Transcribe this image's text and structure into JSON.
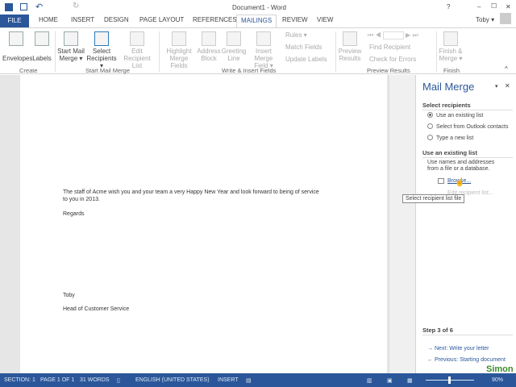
{
  "window": {
    "title": "Document1 - Word",
    "help": "?",
    "minimize": "–",
    "maximize": "☐",
    "close": "✕"
  },
  "qat": {
    "undo": "↶",
    "redo": "↻"
  },
  "user": {
    "name": "Toby ▾"
  },
  "tabs": [
    "FILE",
    "HOME",
    "INSERT",
    "DESIGN",
    "PAGE LAYOUT",
    "REFERENCES",
    "MAILINGS",
    "REVIEW",
    "VIEW"
  ],
  "ribbon": {
    "create": {
      "label": "Create",
      "envelopes": "Envelopes",
      "labels": "Labels"
    },
    "start": {
      "label": "Start Mail Merge",
      "start_mail_merge": [
        "Start Mail",
        "Merge ▾"
      ],
      "select_recipients": [
        "Select",
        "Recipients ▾"
      ],
      "edit_list": [
        "Edit",
        "Recipient List"
      ]
    },
    "write": {
      "label": "Write & Insert Fields",
      "highlight": [
        "Highlight",
        "Merge Fields"
      ],
      "address": [
        "Address",
        "Block"
      ],
      "greeting": [
        "Greeting",
        "Line"
      ],
      "insert_field": [
        "Insert Merge",
        "Field ▾"
      ],
      "rules": "Rules ▾",
      "match": "Match Fields",
      "update": "Update Labels"
    },
    "preview": {
      "label": "Preview Results",
      "preview": [
        "Preview",
        "Results"
      ],
      "find": "Find Recipient",
      "check": "Check for Errors"
    },
    "finish": {
      "label": "Finish",
      "finish_merge": [
        "Finish &",
        "Merge ▾"
      ]
    }
  },
  "document": {
    "paragraph1_line1": "The staff of Acme wish you and your team a very Happy New Year and look forward to being of service",
    "paragraph1_line2": "to you in 2013.",
    "closing": "Regards",
    "name": "Toby",
    "title": "Head of Customer Service"
  },
  "pane": {
    "title": "Mail Merge",
    "select_heading": "Select recipients",
    "options": [
      "Use an existing list",
      "Select from Outlook contacts",
      "Type a new list"
    ],
    "selected_option": 0,
    "existing_heading": "Use an existing list",
    "description": [
      "Use names and addresses",
      "from a file or a database."
    ],
    "browse": "Browse...",
    "edit_list": "Edit recipient list...",
    "tooltip": "Select recipient list file",
    "step": "Step 3 of 6",
    "next": "Next: Write your letter",
    "previous": "Previous: Starting document"
  },
  "status": {
    "section": "SECTION: 1",
    "page": "PAGE 1 OF 1",
    "words": "31 WORDS",
    "language": "ENGLISH (UNITED STATES)",
    "mode": "INSERT",
    "zoom": "90%"
  },
  "watermark": {
    "text": "Simon"
  }
}
